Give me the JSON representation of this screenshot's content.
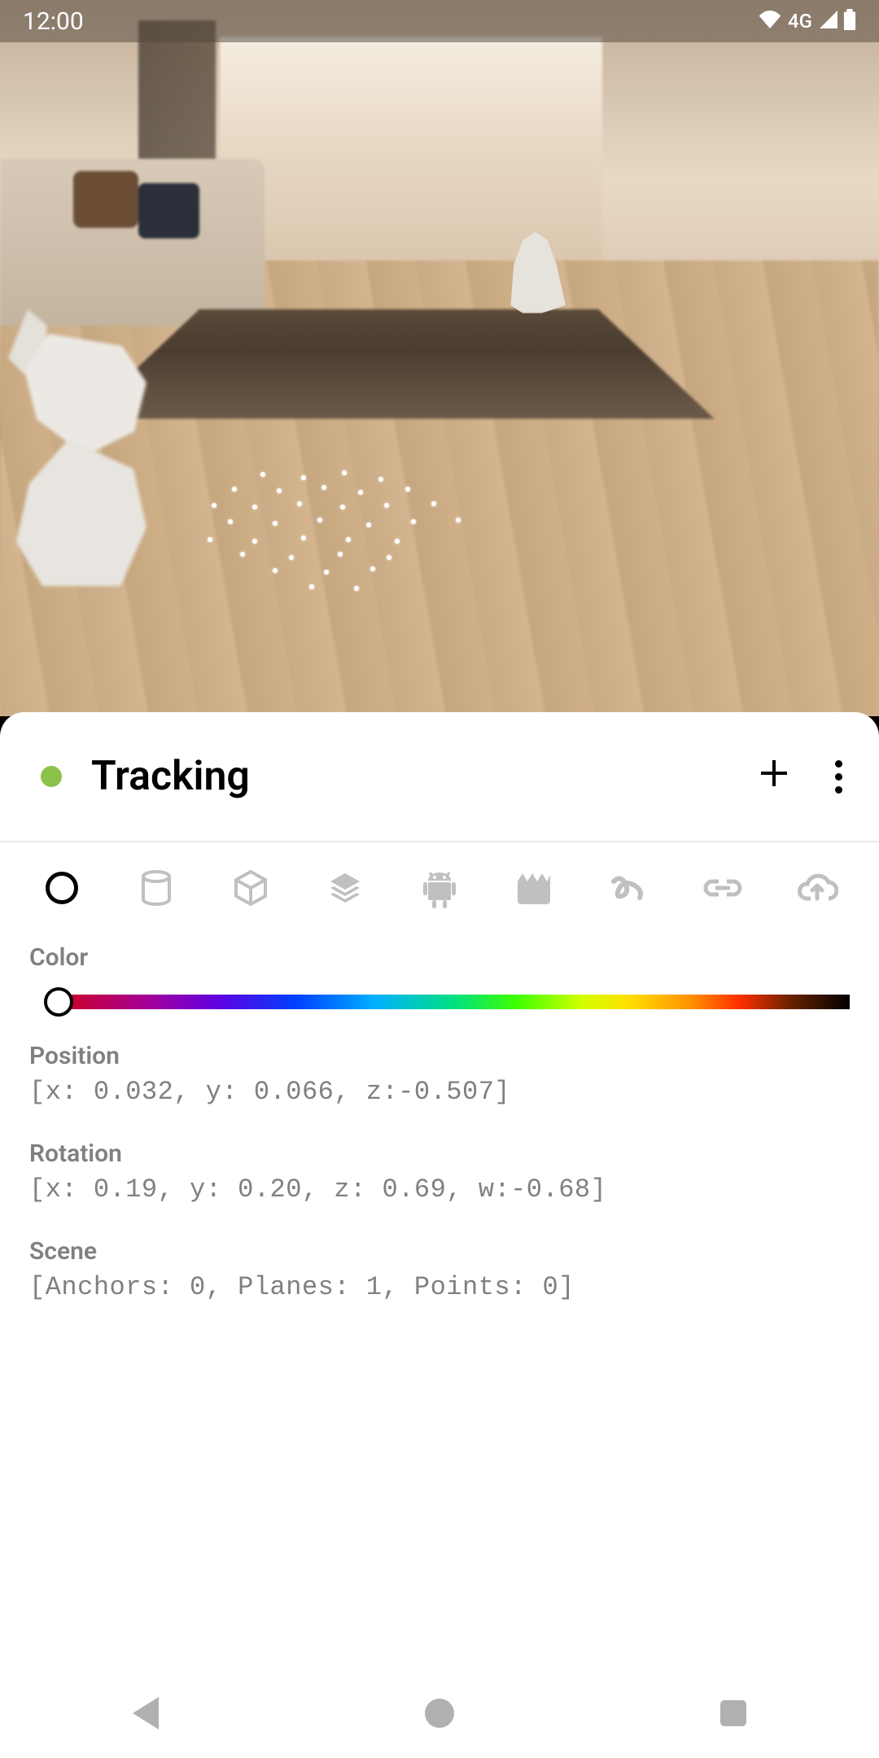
{
  "status_bar": {
    "time": "12:00",
    "network": "4G"
  },
  "panel": {
    "title": "Tracking",
    "status_color": "#8bc34a"
  },
  "sections": {
    "color_label": "Color",
    "position_label": "Position",
    "position_value": "[x: 0.032, y: 0.066, z:-0.507]",
    "rotation_label": "Rotation",
    "rotation_value": "[x: 0.19, y: 0.20, z: 0.69, w:-0.68]",
    "scene_label": "Scene",
    "scene_value": "[Anchors: 0, Planes: 1, Points: 0]"
  },
  "tools": [
    {
      "name": "circle",
      "active": true
    },
    {
      "name": "cylinder",
      "active": false
    },
    {
      "name": "cube",
      "active": false
    },
    {
      "name": "layers",
      "active": false
    },
    {
      "name": "android",
      "active": false
    },
    {
      "name": "video",
      "active": false
    },
    {
      "name": "gesture",
      "active": false
    },
    {
      "name": "link",
      "active": false
    },
    {
      "name": "cloud-upload",
      "active": false
    }
  ]
}
